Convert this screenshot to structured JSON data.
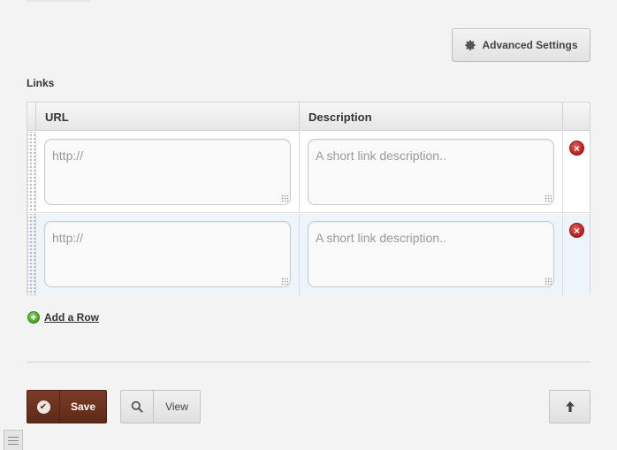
{
  "header": {
    "advanced_settings_label": "Advanced Settings",
    "advanced_settings_icon": "gear-icon"
  },
  "links": {
    "section_label": "Links",
    "columns": [
      "URL",
      "Description"
    ],
    "rows": [
      {
        "url_value": "",
        "url_placeholder": "http://",
        "description_value": "",
        "description_placeholder": "A short link description.."
      },
      {
        "url_value": "",
        "url_placeholder": "http://",
        "description_value": "",
        "description_placeholder": "A short link description.."
      }
    ],
    "remove_icon": "remove-icon",
    "add_row_label": "Add a Row",
    "add_row_icon": "plus-icon"
  },
  "footer": {
    "save_label": "Save",
    "view_label": "View",
    "scroll_top_icon": "arrow-up-icon"
  },
  "colors": {
    "save_button": "#6b311e",
    "remove_icon": "#c62828",
    "add_icon": "#4caf2e",
    "alt_row_bg": "#eef4fb"
  }
}
